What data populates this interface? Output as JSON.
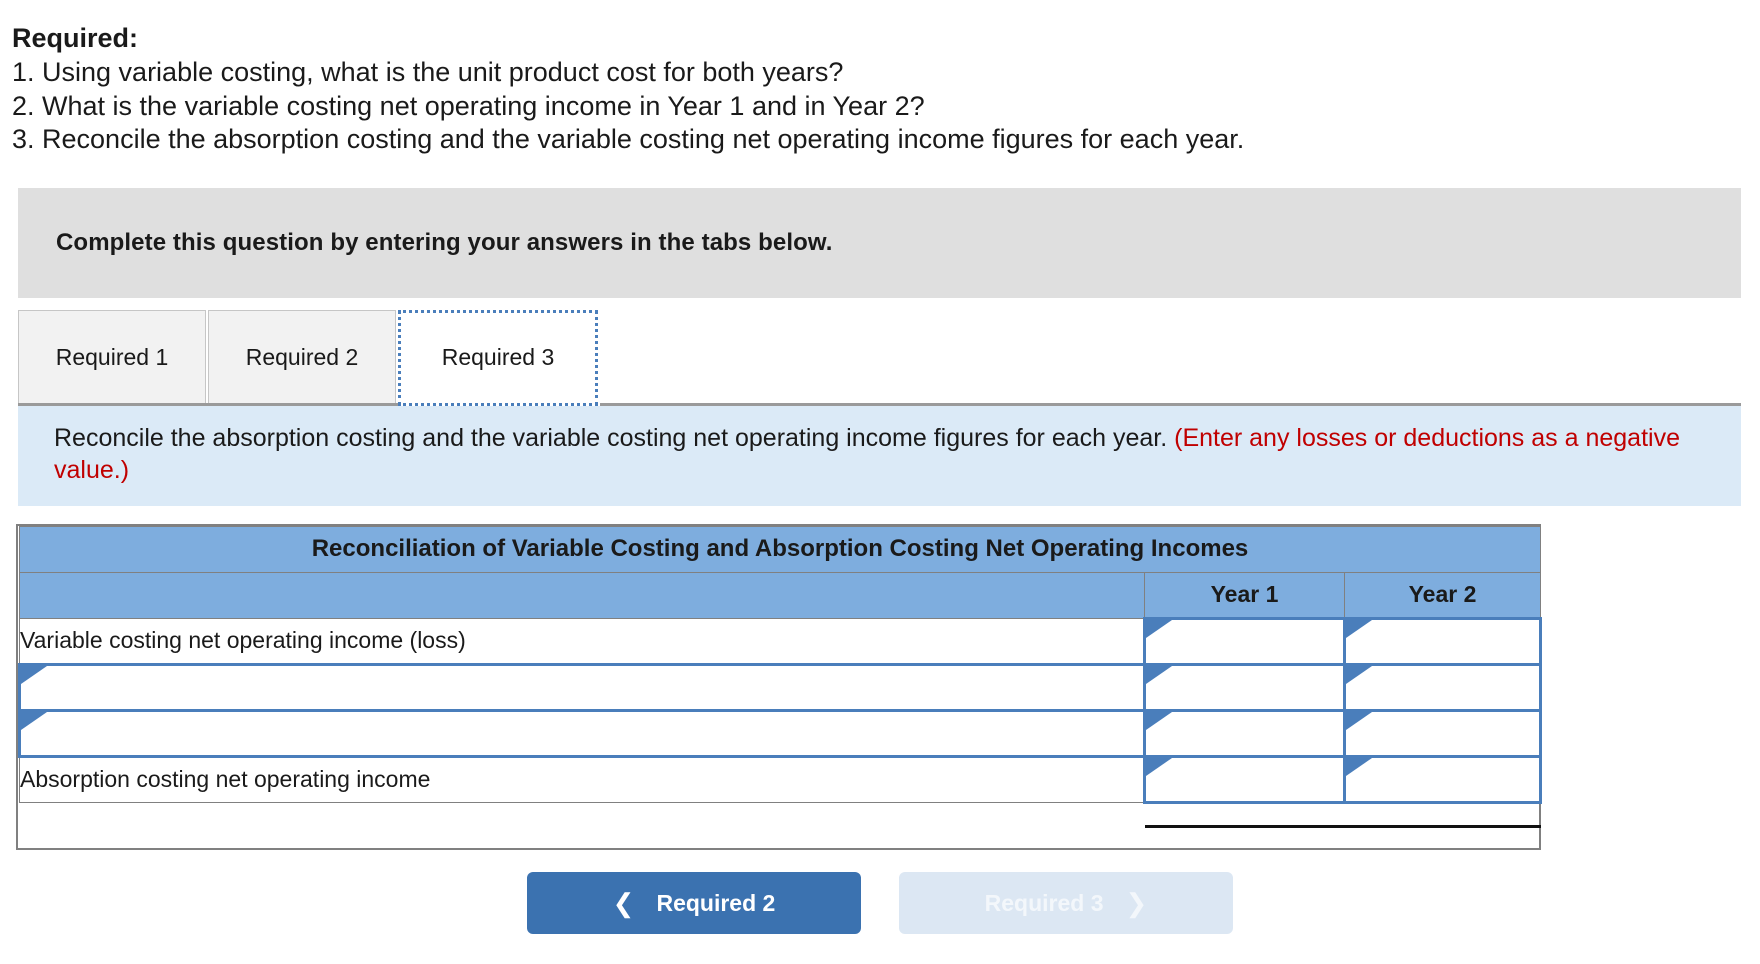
{
  "prompt": {
    "title": "Required:",
    "lines": [
      "1. Using variable costing, what is the unit product cost for both years?",
      "2. What is the variable costing net operating income in Year 1 and in Year 2?",
      "3. Reconcile the absorption costing and the variable costing net operating income figures for each year."
    ]
  },
  "banner": {
    "text": "Complete this question by entering your answers in the tabs below."
  },
  "tabs": [
    {
      "label": "Required 1",
      "active": false
    },
    {
      "label": "Required 2",
      "active": false
    },
    {
      "label": "Required 3",
      "active": true
    }
  ],
  "instruction": {
    "main": "Reconcile the absorption costing and the variable costing net operating income figures for each year.",
    "hint": "(Enter any losses or deductions as a negative value.)"
  },
  "table": {
    "title": "Reconciliation of Variable Costing and Absorption Costing Net Operating Incomes",
    "columns": [
      "",
      "Year 1",
      "Year 2"
    ],
    "rows": [
      {
        "label": "Variable costing net operating income (loss)",
        "label_editable": false,
        "year1": "",
        "year2": "",
        "total": false
      },
      {
        "label": "",
        "label_editable": true,
        "year1": "",
        "year2": "",
        "total": false
      },
      {
        "label": "",
        "label_editable": true,
        "year1": "",
        "year2": "",
        "total": false
      },
      {
        "label": "Absorption costing net operating income",
        "label_editable": false,
        "year1": "",
        "year2": "",
        "total": true
      }
    ]
  },
  "nav": {
    "prev_label": "Required 2",
    "prev_icon": "chevron-left-icon",
    "next_label": "Required 3",
    "next_icon": "chevron-right-icon"
  },
  "colors": {
    "banner_bg": "#dfdfdf",
    "instruction_bg": "#dbeaf7",
    "hint_text": "#c00000",
    "table_header_bg": "#7eadde",
    "input_border": "#4a7ebb",
    "prev_btn_bg": "#3b72b0",
    "next_btn_bg": "#dce7f3"
  }
}
